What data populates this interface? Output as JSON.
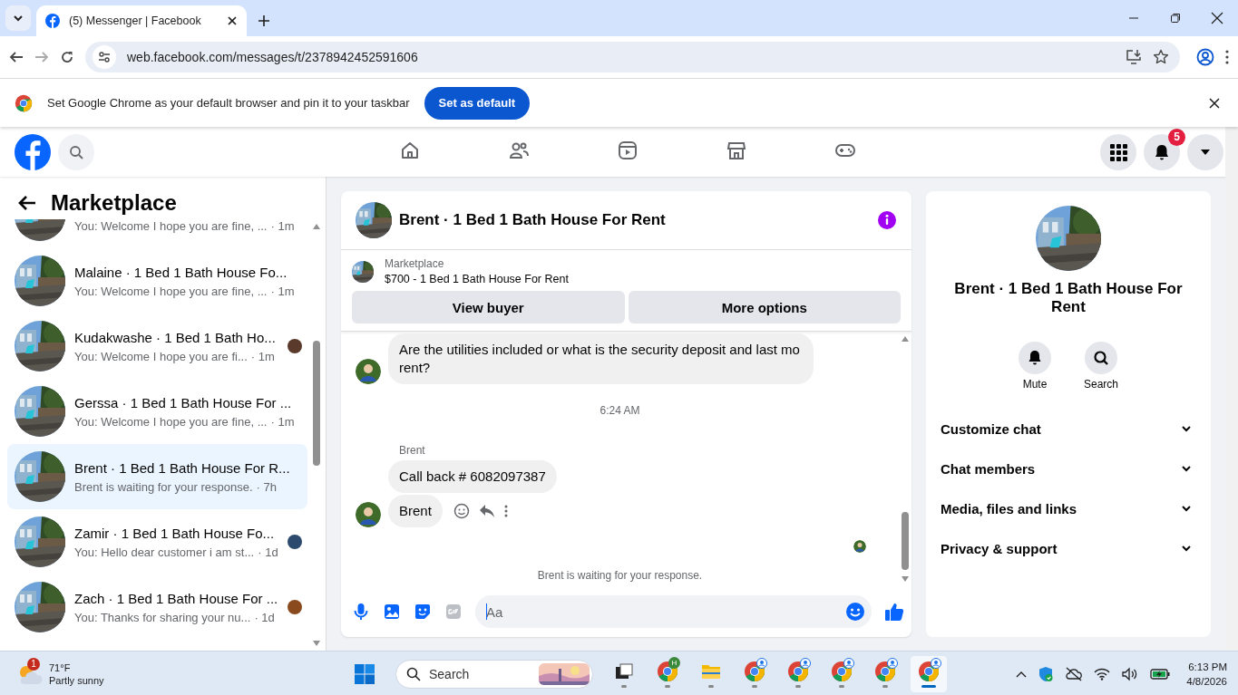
{
  "browser": {
    "tab_title": "(5) Messenger | Facebook",
    "url": "web.facebook.com/messages/t/2378942452591606"
  },
  "infobar": {
    "text": "Set Google Chrome as your default browser and pin it to your taskbar",
    "button": "Set as default"
  },
  "fb_nav": {
    "tabs": [
      {
        "selected": false
      },
      {
        "selected": false
      },
      {
        "selected": false
      },
      {
        "selected": false
      },
      {
        "selected": false
      }
    ],
    "notification_count": "5"
  },
  "sidebar": {
    "title": "Marketplace",
    "conversations": [
      {
        "preview": "You: Welcome I hope you are fine, ...",
        "time": "· 1m",
        "selected": false
      },
      {
        "name": "Malaine · 1 Bed 1 Bath House Fo...",
        "preview": "You: Welcome I hope you are fine, ...",
        "time": "· 1m",
        "selected": false
      },
      {
        "name": "Kudakwashe · 1 Bed 1 Bath Ho...",
        "preview": "You: Welcome I hope you are fi...",
        "time": "· 1m",
        "selected": false,
        "color": "#5a3a2a"
      },
      {
        "name": "Gerssa · 1 Bed 1 Bath House For ...",
        "preview": "You: Welcome I hope you are fine, ...",
        "time": "· 1m",
        "selected": false
      },
      {
        "name": "Brent · 1 Bed 1 Bath House For R...",
        "preview": "Brent is waiting for your response.",
        "time": "· 7h",
        "selected": true
      },
      {
        "name": "Zamir · 1 Bed 1 Bath House Fo...",
        "preview": "You: Hello dear customer i am st...",
        "time": "· 1d",
        "selected": false,
        "color": "#2c4a6e"
      },
      {
        "name": "Zach · 1 Bed 1 Bath House For ...",
        "preview": "You: Thanks for sharing your nu...",
        "time": "· 1d",
        "selected": false,
        "color": "#8a4a1e"
      }
    ]
  },
  "chat": {
    "title": "Brent · 1 Bed 1 Bath House For Rent",
    "listing": {
      "label": "Marketplace",
      "title": "$700 - 1 Bed 1 Bath House For Rent",
      "buttons": [
        "View buyer",
        "More options"
      ]
    },
    "messages": [
      {
        "kind": "bubble",
        "text": "Are the utilities included or what is the security deposit and last mo rent?",
        "avatar": true,
        "actions": false
      },
      {
        "kind": "time",
        "text": "6:24 AM"
      },
      {
        "kind": "sender",
        "text": "Brent"
      },
      {
        "kind": "bubble",
        "text": "Call back # 6082097387",
        "avatar": false,
        "actions": false
      },
      {
        "kind": "bubble",
        "text": "Brent",
        "avatar": true,
        "actions": true
      },
      {
        "kind": "seen"
      },
      {
        "kind": "status",
        "text": "Brent is waiting for your response."
      }
    ],
    "composer": {
      "placeholder": "Aa"
    }
  },
  "details": {
    "title": "Brent · 1 Bed 1 Bath House For Rent",
    "actions": [
      "Mute",
      "Search"
    ],
    "sections": [
      {
        "label": "Customize chat",
        "expanded": false
      },
      {
        "label": "Chat members",
        "expanded": false
      },
      {
        "label": "Media, files and links",
        "expanded": false
      },
      {
        "label": "Privacy & support",
        "expanded": false
      }
    ]
  },
  "taskbar": {
    "weather": {
      "badge": "1",
      "temperature": "71°F",
      "condition": "Partly sunny"
    },
    "search": {
      "placeholder": "Search"
    },
    "apps": [
      {
        "kind": "taskview",
        "selected": false
      },
      {
        "kind": "chrome",
        "badge": "H",
        "selected": false
      },
      {
        "kind": "folder",
        "selected": false
      },
      {
        "kind": "chrome",
        "selected": false
      },
      {
        "kind": "chrome",
        "selected": false
      },
      {
        "kind": "chrome",
        "selected": false
      },
      {
        "kind": "chrome",
        "selected": false
      },
      {
        "kind": "chrome",
        "selected": true
      }
    ],
    "time": "6:13 PM",
    "date": "4/8/2026"
  }
}
